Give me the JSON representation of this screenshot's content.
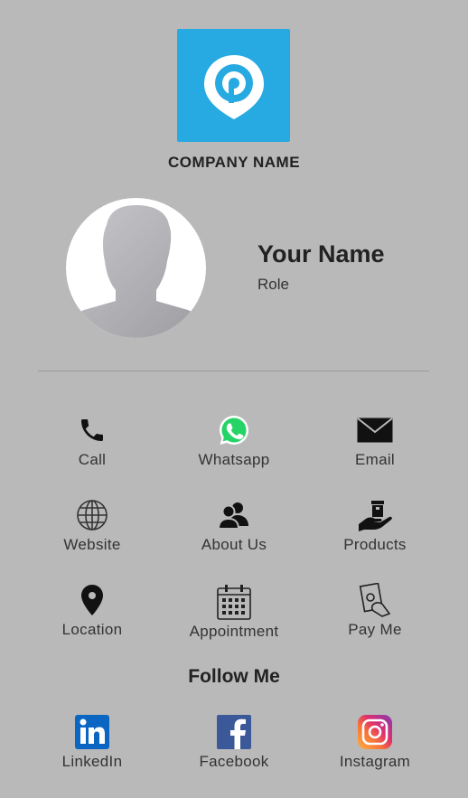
{
  "header": {
    "company_name": "COMPANY NAME"
  },
  "profile": {
    "name": "Your Name",
    "role": "Role"
  },
  "actions": {
    "call": {
      "label": "Call",
      "icon": "phone-icon"
    },
    "whatsapp": {
      "label": "Whatsapp",
      "icon": "whatsapp-icon"
    },
    "email": {
      "label": "Email",
      "icon": "envelope-icon"
    },
    "website": {
      "label": "Website",
      "icon": "globe-icon"
    },
    "about": {
      "label": "About Us",
      "icon": "people-icon"
    },
    "products": {
      "label": "Products",
      "icon": "hand-box-icon"
    },
    "location": {
      "label": "Location",
      "icon": "map-pin-icon"
    },
    "appointment": {
      "label": "Appointment",
      "icon": "calendar-icon"
    },
    "payme": {
      "label": "Pay Me",
      "icon": "hand-money-icon"
    }
  },
  "follow": {
    "title": "Follow Me",
    "linkedin": {
      "label": "LinkedIn",
      "icon": "linkedin-icon"
    },
    "facebook": {
      "label": "Facebook",
      "icon": "facebook-icon"
    },
    "instagram": {
      "label": "Instagram",
      "icon": "instagram-icon"
    }
  },
  "colors": {
    "background": "#b9b9b9",
    "logo": "#27a9e1",
    "whatsapp": "#25d366",
    "linkedin": "#0a66c2",
    "facebook": "#3b5998"
  }
}
